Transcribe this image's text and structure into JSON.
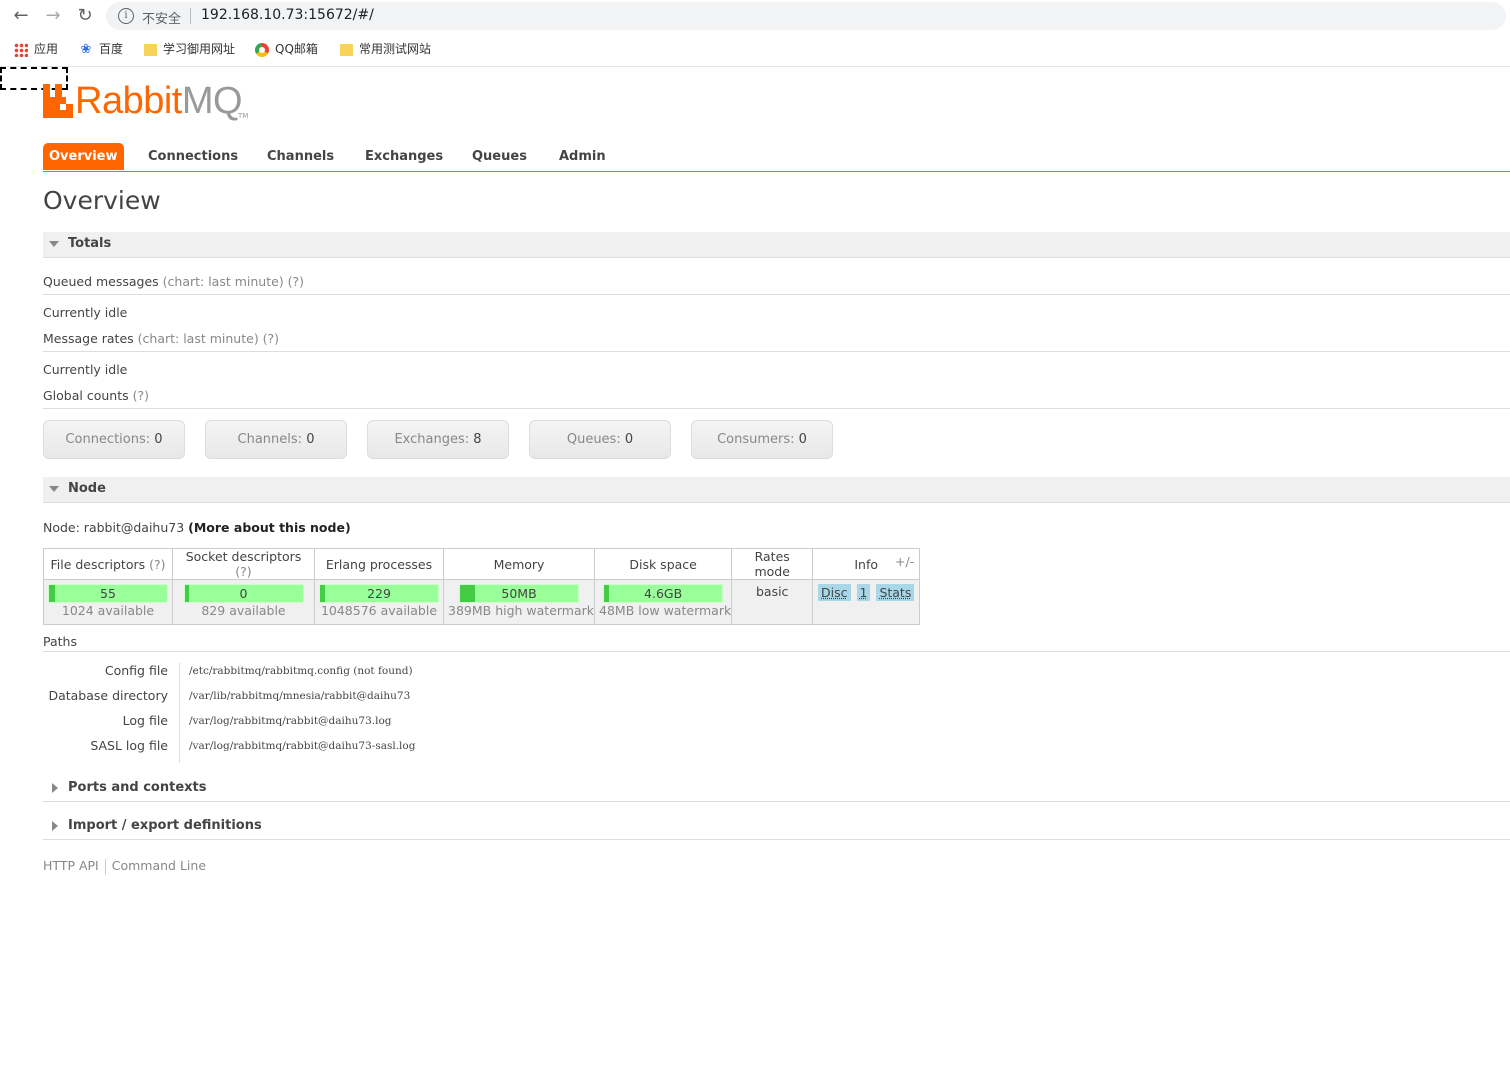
{
  "browser": {
    "back_icon": "arrow-left-icon",
    "forward_icon": "arrow-right-icon",
    "reload_icon": "reload-icon",
    "security_label": "不安全",
    "url": "192.168.10.73:15672/#/",
    "bookmarks": [
      {
        "label": "应用",
        "icon": "apps-grid-icon"
      },
      {
        "label": "百度",
        "icon": "baidu-paw-icon"
      },
      {
        "label": "学习御用网址",
        "icon": "folder-icon"
      },
      {
        "label": "QQ邮箱",
        "icon": "qq-mail-icon"
      },
      {
        "label": "常用测试网站",
        "icon": "folder-icon"
      }
    ]
  },
  "logo": {
    "rabbit": "Rabbit",
    "mq": "MQ",
    "tm": "TM"
  },
  "tabs": [
    "Overview",
    "Connections",
    "Channels",
    "Exchanges",
    "Queues",
    "Admin"
  ],
  "page_title": "Overview",
  "totals": {
    "title": "Totals",
    "queued_messages": "Queued messages",
    "queued_hint": "(chart: last minute) (?)",
    "queued_status": "Currently idle",
    "message_rates": "Message rates",
    "rates_hint": "(chart: last minute) (?)",
    "rates_status": "Currently idle",
    "global_counts": "Global counts",
    "global_hint": "(?)",
    "counts": [
      {
        "label": "Connections:",
        "value": "0"
      },
      {
        "label": "Channels:",
        "value": "0"
      },
      {
        "label": "Exchanges:",
        "value": "8"
      },
      {
        "label": "Queues:",
        "value": "0"
      },
      {
        "label": "Consumers:",
        "value": "0"
      }
    ]
  },
  "node": {
    "title": "Node",
    "node_label": "Node: rabbit@daihu73",
    "more_link": "(More about this node)",
    "headers": {
      "file_descriptors": "File descriptors",
      "socket_descriptors": "Socket descriptors",
      "erlang_processes": "Erlang processes",
      "memory": "Memory",
      "disk_space": "Disk space",
      "rates_mode": "Rates mode",
      "info": "Info",
      "help": "(?)"
    },
    "file_descriptors": {
      "value": "55",
      "sub": "1024 available",
      "used_fraction": 0.054
    },
    "socket_descriptors": {
      "value": "0",
      "sub": "829 available",
      "used_fraction": 0
    },
    "erlang_processes": {
      "value": "229",
      "sub": "1048576 available",
      "used_fraction": 0.0002
    },
    "memory": {
      "value": "50MB",
      "sub": "389MB high watermark",
      "used_fraction": 0.13
    },
    "disk_space": {
      "value": "4.6GB",
      "sub": "48MB low watermark",
      "used_fraction": 0.0
    },
    "rates_mode": "basic",
    "info_tags": [
      "Disc",
      "1",
      "Stats"
    ],
    "plus_minus": "+/-"
  },
  "paths": {
    "title": "Paths",
    "rows": [
      {
        "key": "Config file",
        "value": "/etc/rabbitmq/rabbitmq.config (not found)"
      },
      {
        "key": "Database directory",
        "value": "/var/lib/rabbitmq/mnesia/rabbit@daihu73"
      },
      {
        "key": "Log file",
        "value": "/var/log/rabbitmq/rabbit@daihu73.log"
      },
      {
        "key": "SASL log file",
        "value": "/var/log/rabbitmq/rabbit@daihu73-sasl.log"
      }
    ]
  },
  "sections": {
    "ports": "Ports and contexts",
    "import_export": "Import / export definitions"
  },
  "footer": {
    "http_api": "HTTP API",
    "command_line": "Command Line"
  },
  "colors": {
    "accent": "#ff6600",
    "bar_fill": "#99ff99",
    "bar_used": "#44cc44",
    "info_tag": "#a8d8e8"
  }
}
